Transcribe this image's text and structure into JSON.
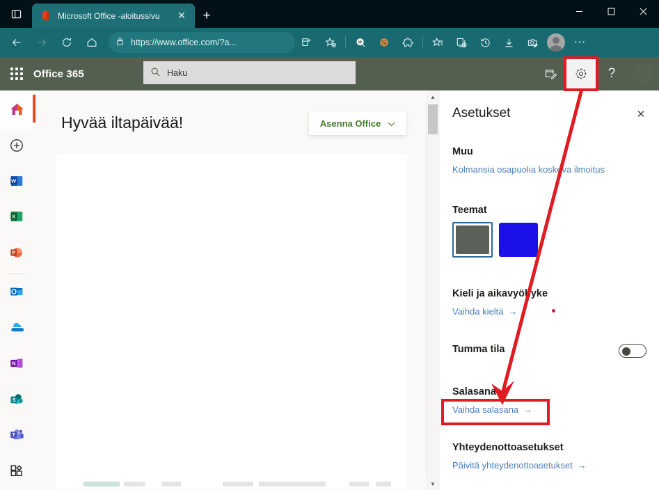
{
  "browser": {
    "tab": {
      "title": "Microsoft Office -aloitussivu",
      "favicon": "office-icon",
      "close": "✕"
    },
    "new_tab": "+",
    "tab_list_icon": "tab-list-icon",
    "window_controls": {
      "minimize": "—",
      "maximize": "❑",
      "close": "✕"
    },
    "nav": {
      "back": "←",
      "forward": "→",
      "refresh": "↻",
      "home": "⌂"
    },
    "omnibox": {
      "lock_icon": "lock-icon",
      "url": "https://www.office.com/?a..."
    },
    "toolbar_icons": [
      "split-screen-icon",
      "favorite-add-icon",
      "ip-lookup-icon",
      "cookie-icon",
      "extensions-icon",
      "collections-favorites-icon",
      "collections-icon",
      "history-icon",
      "downloads-icon",
      "screenshot-icon",
      "profile-avatar",
      "more-icon"
    ],
    "more": "⋯"
  },
  "suite_header": {
    "waffle": "app-launcher-icon",
    "brand": "Office 365",
    "search": {
      "placeholder": "Haku",
      "icon": "search-icon"
    },
    "right_icons": [
      {
        "name": "feedback-icon",
        "glyph": "☑"
      },
      {
        "name": "settings-gear-icon",
        "glyph": "⚙",
        "highlighted": true
      },
      {
        "name": "help-icon",
        "glyph": "?"
      }
    ],
    "highlight_color": "#e01b22"
  },
  "rail": {
    "items": [
      {
        "name": "home",
        "icon": "home-icon",
        "active": true
      },
      {
        "name": "create",
        "icon": "plus-circle-icon",
        "active": false
      },
      {
        "name": "word",
        "icon": "word-icon",
        "letter": "W",
        "color": "#185abd",
        "active": false
      },
      {
        "name": "excel",
        "icon": "excel-icon",
        "letter": "X",
        "color": "#107c41",
        "active": false
      },
      {
        "name": "powerpoint",
        "icon": "powerpoint-icon",
        "letter": "P",
        "color": "#c43e1c",
        "active": false
      },
      {
        "name": "outlook",
        "icon": "outlook-icon",
        "letter": "O",
        "color": "#0f6cbd",
        "active": false
      },
      {
        "name": "onedrive",
        "icon": "onedrive-icon",
        "letter": "",
        "color": "#0f7ec8",
        "active": false
      },
      {
        "name": "onenote",
        "icon": "onenote-icon",
        "letter": "N",
        "color": "#7719aa",
        "active": false
      },
      {
        "name": "sharepoint",
        "icon": "sharepoint-icon",
        "letter": "S",
        "color": "#038387",
        "active": false
      },
      {
        "name": "teams",
        "icon": "teams-icon",
        "letter": "T",
        "color": "#5059c9",
        "active": false
      },
      {
        "name": "all-apps",
        "icon": "all-apps-icon",
        "letter": "",
        "color": "#201f1e",
        "active": false
      }
    ]
  },
  "main": {
    "greeting": "Hyvää iltapäivää!",
    "install_button": {
      "label": "Asenna Office",
      "chevron": "∨"
    }
  },
  "scrollbar": {
    "up": "▲",
    "down": "▼"
  },
  "panel": {
    "title": "Asetukset",
    "close": "✕",
    "sections": {
      "other": {
        "heading": "Muu",
        "link": "Kolmansia osapuolia koskeva ilmoitus"
      },
      "themes": {
        "heading": "Teemat",
        "swatches": [
          {
            "color": "#5c6159",
            "selected": true
          },
          {
            "color": "#1b10e8",
            "selected": false
          }
        ]
      },
      "language": {
        "heading": "Kieli ja aikavyöhyke",
        "link": "Vaihda kieltä",
        "arrow": "→"
      },
      "dark_mode": {
        "heading": "Tumma tila",
        "toggle_on": false
      },
      "password": {
        "heading": "Salasana",
        "link": "Vaihda salasana",
        "arrow": "→",
        "highlighted": true
      },
      "contact": {
        "heading": "Yhteydenottoasetukset",
        "link": "Päivitä yhteydenottoasetukset",
        "arrow": "→"
      }
    }
  },
  "annotation": {
    "arrow_color": "#e01b22",
    "from": "settings-gear-icon",
    "to": "Vaihda salasana"
  }
}
